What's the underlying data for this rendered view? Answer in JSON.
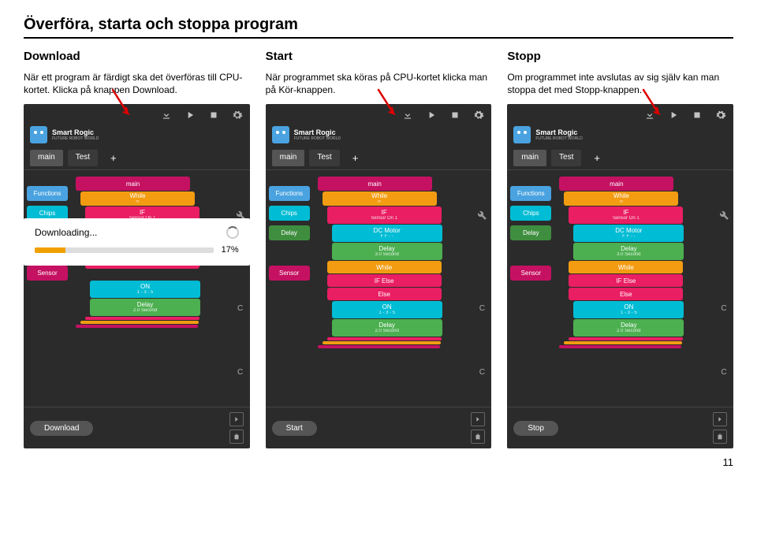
{
  "page": {
    "title": "Överföra, starta och stoppa program",
    "page_number": "11"
  },
  "columns": [
    {
      "heading": "Download",
      "text": "När ett program är färdigt ska det överföras till CPU-kortet.\nKlicka på knappen Download.",
      "run_label": "Download",
      "arrow_target": "download-icon",
      "show_modal": true
    },
    {
      "heading": "Start",
      "text": "När programmet ska köras på CPU-kortet klicka man på Kör-knappen.",
      "run_label": "Start",
      "arrow_target": "play-icon",
      "show_modal": false
    },
    {
      "heading": "Stopp",
      "text": "Om programmet inte avslutas av sig själv kan man stoppa det med Stopp-knappen.",
      "run_label": "Stop",
      "arrow_target": "stop-icon",
      "show_modal": false
    }
  ],
  "app": {
    "logo_title": "Smart Rogic",
    "logo_subtitle": "FUTURE ROBOT WORLD",
    "tabs": [
      "main",
      "Test"
    ],
    "plus": "+",
    "sidebar": {
      "functions": "Functions",
      "chips": "Chips",
      "delay": "Delay",
      "sensor": "Sensor"
    },
    "blocks": {
      "main": "main",
      "while": "While",
      "while_sub": "∞",
      "if": "IF",
      "if_sub": "Sensor On 1",
      "dcmotor": "DC Motor",
      "dcmotor_sub": "F  F  -  -",
      "delay1": "Delay",
      "delay1_sub": "3.0 Second",
      "while2": "While",
      "ifelse": "IF Else",
      "else": "Else",
      "on": "ON",
      "on_sub": "1  -  3  -  5",
      "delay2": "Delay",
      "delay2_sub": "2.0 Second"
    },
    "letter_c": "C"
  },
  "modal": {
    "title": "Downloading...",
    "percent": "17%",
    "fill_width": "17%"
  }
}
